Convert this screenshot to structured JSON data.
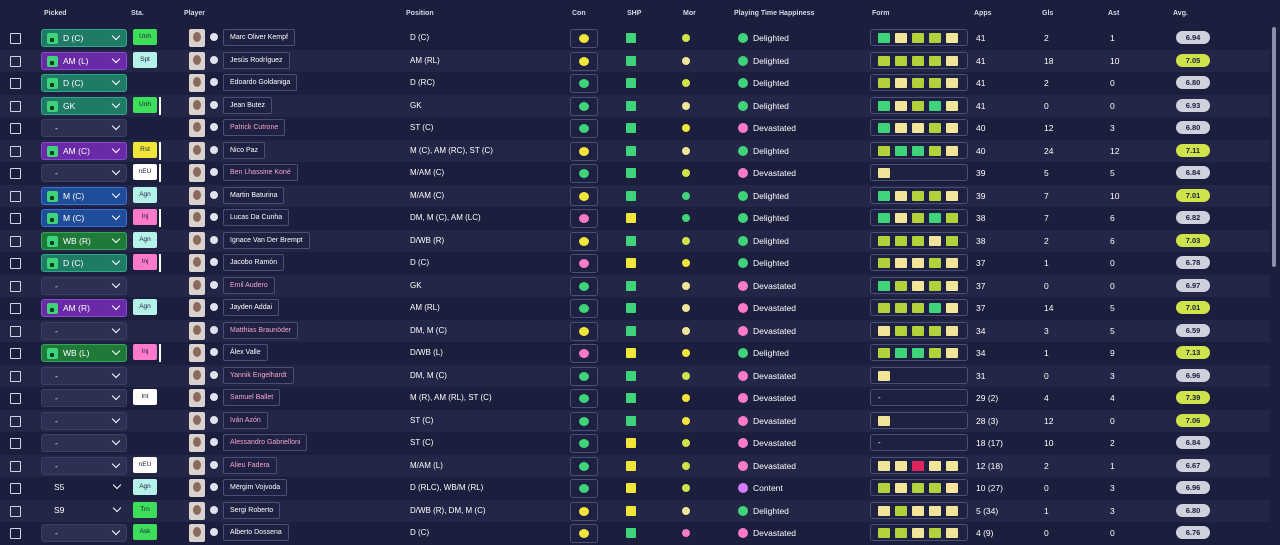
{
  "headers": {
    "picked": "Picked",
    "sta": "Sta.",
    "player": "Player",
    "position": "Position",
    "con": "Con",
    "shp": "SHP",
    "mor": "Mor",
    "pth": "Playing Time Happiness",
    "form": "Form",
    "apps": "Apps",
    "gls": "Gls",
    "ast": "Ast",
    "avg": "Avg."
  },
  "colors": {
    "delighted": "#3fd37a",
    "devastated": "#ff7acb",
    "content": "#d67aff"
  },
  "rows": [
    {
      "picked": "D (C)",
      "pos_style": "pos-d",
      "sta": "Unh",
      "sta_style": "green",
      "sta_bar": false,
      "name": "Marc Oliver Kempf",
      "name_pink": false,
      "position": "D (C)",
      "con": "#f2e53a",
      "shp": "green",
      "mor": "#cfe34a",
      "pth": "Delighted",
      "form": [
        "#3fd37a",
        "#f2e59a",
        "#b2d13a",
        "#b2d13a",
        "#f2e59a"
      ],
      "apps": "41",
      "gls": "2",
      "ast": "1",
      "avg": "6.94",
      "avg_style": "grey"
    },
    {
      "picked": "AM (L)",
      "pos_style": "pos-am",
      "sta": "Spt",
      "sta_style": "light",
      "sta_bar": false,
      "name": "Jesús Rodríguez",
      "name_pink": false,
      "position": "AM (RL)",
      "con": "#f2e53a",
      "shp": "green",
      "mor": "#f2e59a",
      "pth": "Delighted",
      "form": [
        "#b2d13a",
        "#b2d13a",
        "#b2d13a",
        "#b2d13a",
        "#f2e59a"
      ],
      "apps": "41",
      "gls": "18",
      "ast": "10",
      "avg": "7.05",
      "avg_style": "lime"
    },
    {
      "picked": "D (C)",
      "pos_style": "pos-d",
      "sta": "",
      "sta_style": "",
      "sta_bar": false,
      "name": "Edoardo Goldaniga",
      "name_pink": false,
      "position": "D (RC)",
      "con": "#3fd37a",
      "shp": "green",
      "mor": "#cfe34a",
      "pth": "Delighted",
      "form": [
        "#b2d13a",
        "#f2e59a",
        "#b2d13a",
        "#b2d13a",
        "#f2e59a"
      ],
      "apps": "41",
      "gls": "2",
      "ast": "0",
      "avg": "6.80",
      "avg_style": "grey"
    },
    {
      "picked": "GK",
      "pos_style": "pos-gk",
      "sta": "Unh",
      "sta_style": "green",
      "sta_bar": true,
      "name": "Jean Butez",
      "name_pink": false,
      "position": "GK",
      "con": "#3fd37a",
      "shp": "green",
      "mor": "#f2e59a",
      "pth": "Delighted",
      "form": [
        "#3fd37a",
        "#f2e59a",
        "#b2d13a",
        "#3fd37a",
        "#f2e59a"
      ],
      "apps": "41",
      "gls": "0",
      "ast": "0",
      "avg": "6.93",
      "avg_style": "grey"
    },
    {
      "picked": "-",
      "pos_style": "none",
      "sta": "",
      "sta_style": "",
      "sta_bar": false,
      "name": "Patrick Cutrone",
      "name_pink": true,
      "position": "ST (C)",
      "con": "#3fd37a",
      "shp": "green",
      "mor": "#f2e53a",
      "pth": "Devastated",
      "form": [
        "#3fd37a",
        "#f2e59a",
        "#f2e59a",
        "#b2d13a",
        "#f2e59a"
      ],
      "apps": "40",
      "gls": "12",
      "ast": "3",
      "avg": "6.80",
      "avg_style": "grey"
    },
    {
      "picked": "AM (C)",
      "pos_style": "pos-am",
      "sta": "Rst",
      "sta_style": "yellow",
      "sta_bar": true,
      "name": "Nico Paz",
      "name_pink": false,
      "position": "M (C), AM (RC), ST (C)",
      "con": "#f2e53a",
      "shp": "green",
      "mor": "#f2e59a",
      "pth": "Delighted",
      "form": [
        "#b2d13a",
        "#3fd37a",
        "#3fd37a",
        "#b2d13a",
        "#f2e59a"
      ],
      "apps": "40",
      "gls": "24",
      "ast": "12",
      "avg": "7.11",
      "avg_style": "lime"
    },
    {
      "picked": "-",
      "pos_style": "none",
      "sta": "nEU",
      "sta_style": "white",
      "sta_bar": true,
      "name": "Ben Lhassine Koné",
      "name_pink": true,
      "position": "M/AM (C)",
      "con": "#3fd37a",
      "shp": "green",
      "mor": "#cfe34a",
      "pth": "Devastated",
      "form": [
        "#f2e59a"
      ],
      "apps": "39",
      "gls": "5",
      "ast": "5",
      "avg": "6.84",
      "avg_style": "grey"
    },
    {
      "picked": "M (C)",
      "pos_style": "pos-m",
      "sta": "Agn",
      "sta_style": "light",
      "sta_bar": false,
      "name": "Martin Baturina",
      "name_pink": false,
      "position": "M/AM (C)",
      "con": "#f2e53a",
      "shp": "green",
      "mor": "#3fd37a",
      "pth": "Delighted",
      "form": [
        "#3fd37a",
        "#f2e59a",
        "#b2d13a",
        "#b2d13a",
        "#f2e59a"
      ],
      "apps": "39",
      "gls": "7",
      "ast": "10",
      "avg": "7.01",
      "avg_style": "lime"
    },
    {
      "picked": "M (C)",
      "pos_style": "pos-m",
      "sta": "Inj",
      "sta_style": "pink",
      "sta_bar": true,
      "name": "Lucas Da Cunha",
      "name_pink": false,
      "position": "DM, M (C), AM (LC)",
      "con": "#ff7acb",
      "shp": "yellow",
      "mor": "#3fd37a",
      "pth": "Delighted",
      "form": [
        "#3fd37a",
        "#f2e59a",
        "#b2d13a",
        "#3fd37a",
        "#b2d13a"
      ],
      "apps": "38",
      "gls": "7",
      "ast": "6",
      "avg": "6.82",
      "avg_style": "grey"
    },
    {
      "picked": "WB (R)",
      "pos_style": "pos-wb",
      "sta": "Agn",
      "sta_style": "light",
      "sta_bar": false,
      "name": "Ignace Van Der Brempt",
      "name_pink": false,
      "position": "D/WB (R)",
      "con": "#f2e53a",
      "shp": "green",
      "mor": "#cfe34a",
      "pth": "Delighted",
      "form": [
        "#b2d13a",
        "#b2d13a",
        "#b2d13a",
        "#f2e59a",
        "#b2d13a"
      ],
      "apps": "38",
      "gls": "2",
      "ast": "6",
      "avg": "7.03",
      "avg_style": "lime"
    },
    {
      "picked": "D (C)",
      "pos_style": "pos-d",
      "sta": "Inj",
      "sta_style": "pink",
      "sta_bar": true,
      "name": "Jacobo Ramón",
      "name_pink": false,
      "position": "D (C)",
      "con": "#ff7acb",
      "shp": "yellow",
      "mor": "#f2e53a",
      "pth": "Delighted",
      "form": [
        "#b2d13a",
        "#f2e59a",
        "#f2e59a",
        "#b2d13a",
        "#f2e59a"
      ],
      "apps": "37",
      "gls": "1",
      "ast": "0",
      "avg": "6.78",
      "avg_style": "grey"
    },
    {
      "picked": "-",
      "pos_style": "none",
      "sta": "",
      "sta_style": "",
      "sta_bar": false,
      "name": "Emil Audero",
      "name_pink": true,
      "position": "GK",
      "con": "#3fd37a",
      "shp": "green",
      "mor": "#f2e59a",
      "pth": "Devastated",
      "form": [
        "#3fd37a",
        "#b2d13a",
        "#f2e59a",
        "#b2d13a",
        "#f2e59a"
      ],
      "apps": "37",
      "gls": "0",
      "ast": "0",
      "avg": "6.97",
      "avg_style": "grey"
    },
    {
      "picked": "AM (R)",
      "pos_style": "pos-am",
      "sta": "Agn",
      "sta_style": "light",
      "sta_bar": false,
      "name": "Jayden Addai",
      "name_pink": false,
      "position": "AM (RL)",
      "con": "#3fd37a",
      "shp": "green",
      "mor": "#f2e59a",
      "pth": "Devastated",
      "form": [
        "#b2d13a",
        "#b2d13a",
        "#b2d13a",
        "#3fd37a",
        "#f2e59a"
      ],
      "apps": "37",
      "gls": "14",
      "ast": "5",
      "avg": "7.01",
      "avg_style": "lime"
    },
    {
      "picked": "-",
      "pos_style": "none",
      "sta": "",
      "sta_style": "",
      "sta_bar": false,
      "name": "Matthias Braunöder",
      "name_pink": true,
      "position": "DM, M (C)",
      "con": "#f2e53a",
      "shp": "green",
      "mor": "#f2e59a",
      "pth": "Devastated",
      "form": [
        "#f2e59a",
        "#b2d13a",
        "#b2d13a",
        "#b2d13a",
        "#f2e59a"
      ],
      "apps": "34",
      "gls": "3",
      "ast": "5",
      "avg": "6.59",
      "avg_style": "grey"
    },
    {
      "picked": "WB (L)",
      "pos_style": "pos-wb",
      "sta": "Inj",
      "sta_style": "pink",
      "sta_bar": true,
      "name": "Álex Valle",
      "name_pink": false,
      "position": "D/WB (L)",
      "con": "#ff7acb",
      "shp": "yellow",
      "mor": "#f2e53a",
      "pth": "Delighted",
      "form": [
        "#b2d13a",
        "#3fd37a",
        "#3fd37a",
        "#b2d13a",
        "#f2e59a"
      ],
      "apps": "34",
      "gls": "1",
      "ast": "9",
      "avg": "7.13",
      "avg_style": "lime"
    },
    {
      "picked": "-",
      "pos_style": "none",
      "sta": "",
      "sta_style": "",
      "sta_bar": false,
      "name": "Yannik Engelhardt",
      "name_pink": true,
      "position": "DM, M (C)",
      "con": "#3fd37a",
      "shp": "green",
      "mor": "#cfe34a",
      "pth": "Devastated",
      "form": [
        "#f2e59a"
      ],
      "apps": "31",
      "gls": "0",
      "ast": "3",
      "avg": "6.96",
      "avg_style": "grey"
    },
    {
      "picked": "-",
      "pos_style": "none",
      "sta": "Int",
      "sta_style": "white",
      "sta_bar": false,
      "name": "Samuel Ballet",
      "name_pink": true,
      "position": "M (R), AM (RL), ST (C)",
      "con": "#3fd37a",
      "shp": "green",
      "mor": "#f2e53a",
      "pth": "Devastated",
      "form": [],
      "form_dash": "-",
      "apps": "29 (2)",
      "gls": "4",
      "ast": "4",
      "avg": "7.39",
      "avg_style": "lime"
    },
    {
      "picked": "-",
      "pos_style": "none",
      "sta": "",
      "sta_style": "",
      "sta_bar": false,
      "name": "Iván Azón",
      "name_pink": true,
      "position": "ST (C)",
      "con": "#3fd37a",
      "shp": "green",
      "mor": "#f2e53a",
      "pth": "Devastated",
      "form": [
        "#f2e59a"
      ],
      "apps": "28 (3)",
      "gls": "12",
      "ast": "0",
      "avg": "7.06",
      "avg_style": "lime"
    },
    {
      "picked": "-",
      "pos_style": "none",
      "sta": "",
      "sta_style": "",
      "sta_bar": false,
      "name": "Alessandro Gabrielloni",
      "name_pink": true,
      "position": "ST (C)",
      "con": "#3fd37a",
      "shp": "yellow",
      "mor": "#cfe34a",
      "pth": "Devastated",
      "form": [],
      "form_dash": "-",
      "apps": "18 (17)",
      "gls": "10",
      "ast": "2",
      "avg": "6.84",
      "avg_style": "grey"
    },
    {
      "picked": "-",
      "pos_style": "none",
      "sta": "nEU",
      "sta_style": "white",
      "sta_bar": false,
      "name": "Alieu Fadera",
      "name_pink": true,
      "position": "M/AM (L)",
      "con": "#3fd37a",
      "shp": "yellow",
      "mor": "#cfe34a",
      "pth": "Devastated",
      "form": [
        "#f2e59a",
        "#f2e59a",
        "#e0245e",
        "#f2e59a",
        "#f2e59a"
      ],
      "apps": "12 (18)",
      "gls": "2",
      "ast": "1",
      "avg": "6.67",
      "avg_style": "grey"
    },
    {
      "picked": "S5",
      "pos_style": "plain",
      "sta": "Agn",
      "sta_style": "light",
      "sta_bar": false,
      "name": "Mërgim Vojvoda",
      "name_pink": false,
      "position": "D (RLC), WB/M (RL)",
      "con": "#3fd37a",
      "shp": "yellow",
      "mor": "#cfe34a",
      "pth": "Content",
      "form": [
        "#b2d13a",
        "#f2e59a",
        "#b2d13a",
        "#b2d13a",
        "#f2e59a"
      ],
      "apps": "10 (27)",
      "gls": "0",
      "ast": "3",
      "avg": "6.96",
      "avg_style": "grey"
    },
    {
      "picked": "S9",
      "pos_style": "plain",
      "sta": "Trn",
      "sta_style": "green",
      "sta_bar": false,
      "name": "Sergi Roberto",
      "name_pink": false,
      "position": "D/WB (R), DM, M (C)",
      "con": "#f2e53a",
      "shp": "yellow",
      "mor": "#f2e59a",
      "pth": "Delighted",
      "form": [
        "#f2e59a",
        "#b2d13a",
        "#f2e59a",
        "#f2e59a",
        "#f2e59a"
      ],
      "apps": "5 (34)",
      "gls": "1",
      "ast": "3",
      "avg": "6.80",
      "avg_style": "grey"
    },
    {
      "picked": "-",
      "pos_style": "none",
      "sta": "Ask",
      "sta_style": "green",
      "sta_bar": false,
      "name": "Alberto Dossena",
      "name_pink": false,
      "position": "D (C)",
      "con": "#f2e53a",
      "shp": "green",
      "mor": "#ff7acb",
      "pth": "Devastated",
      "form": [
        "#b2d13a",
        "#b2d13a",
        "#f2e59a",
        "#b2d13a",
        "#f2e59a"
      ],
      "apps": "4 (9)",
      "gls": "0",
      "ast": "0",
      "avg": "6.76",
      "avg_style": "grey"
    }
  ]
}
